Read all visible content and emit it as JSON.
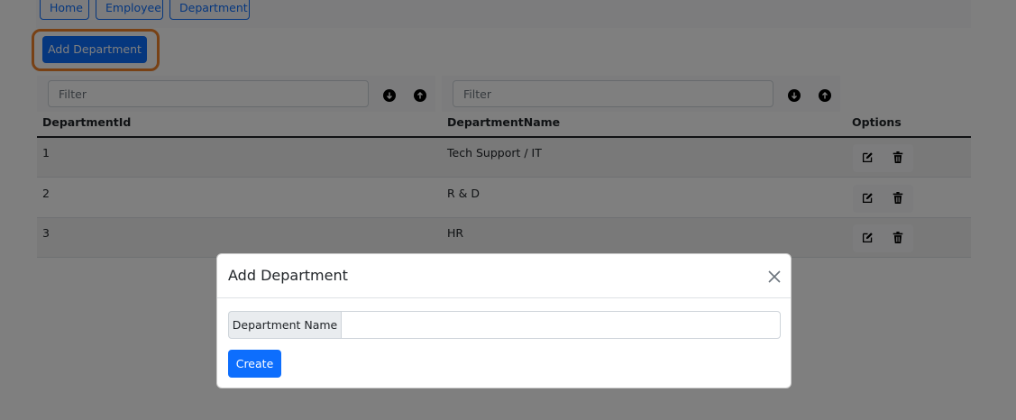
{
  "nav": {
    "items": [
      {
        "label": "Home"
      },
      {
        "label": "Employee"
      },
      {
        "label": "Department"
      }
    ]
  },
  "toolbar": {
    "add_label": "Add Department"
  },
  "filters": [
    {
      "placeholder": "Filter"
    },
    {
      "placeholder": "Filter"
    }
  ],
  "table": {
    "headers": [
      "DepartmentId",
      "DepartmentName",
      "Options"
    ],
    "rows": [
      {
        "id": "1",
        "name": "Tech Support / IT"
      },
      {
        "id": "2",
        "name": "R & D"
      },
      {
        "id": "3",
        "name": "HR"
      }
    ]
  },
  "modal": {
    "title": "Add Department",
    "field_label": "Department Name",
    "field_value": "",
    "create_label": "Create"
  },
  "colors": {
    "primary": "#0d6efd",
    "highlight": "#f0832b"
  },
  "icons": {
    "sort_desc": "arrow-down-circle-icon",
    "sort_asc": "arrow-up-circle-icon",
    "edit": "pencil-square-icon",
    "delete": "trash-icon",
    "close": "close-icon"
  }
}
